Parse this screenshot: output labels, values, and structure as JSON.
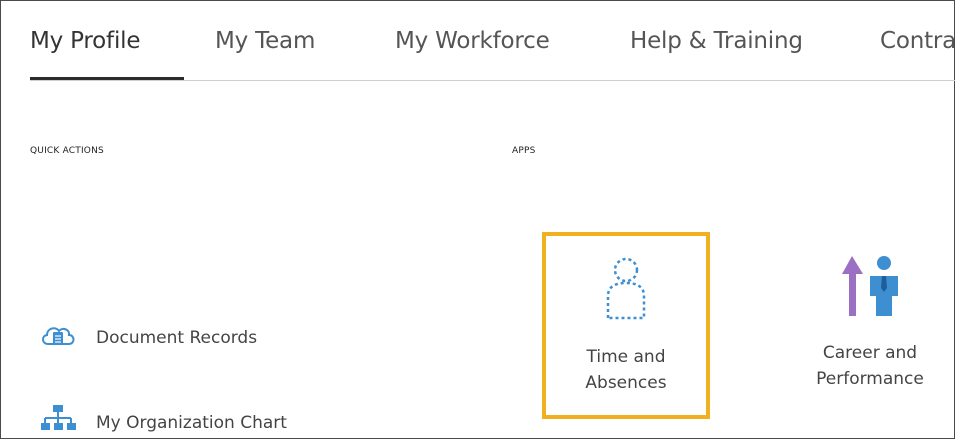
{
  "tabs": [
    {
      "label": "My Profile",
      "active": true
    },
    {
      "label": "My Team",
      "active": false
    },
    {
      "label": "My Workforce",
      "active": false
    },
    {
      "label": "Help & Training",
      "active": false
    },
    {
      "label": "Contra",
      "active": false
    }
  ],
  "quick_actions": {
    "heading": "QUICK ACTIONS",
    "items": [
      {
        "label": "Document Records",
        "icon": "cloud-document-icon"
      },
      {
        "label": "My Organization Chart",
        "icon": "org-chart-icon"
      }
    ]
  },
  "apps": {
    "heading": "APPS",
    "items": [
      {
        "label_line1": "Time and",
        "label_line2": "Absences",
        "icon": "person-outline-icon",
        "highlighted": true
      },
      {
        "label_line1": "Career and",
        "label_line2": "Performance",
        "icon": "career-growth-icon",
        "highlighted": false
      }
    ]
  },
  "colors": {
    "highlight_border": "#f0b020",
    "icon_blue": "#3d8fd1",
    "icon_purple": "#9b6fc1",
    "active_tab_underline": "#2b2b2b"
  }
}
